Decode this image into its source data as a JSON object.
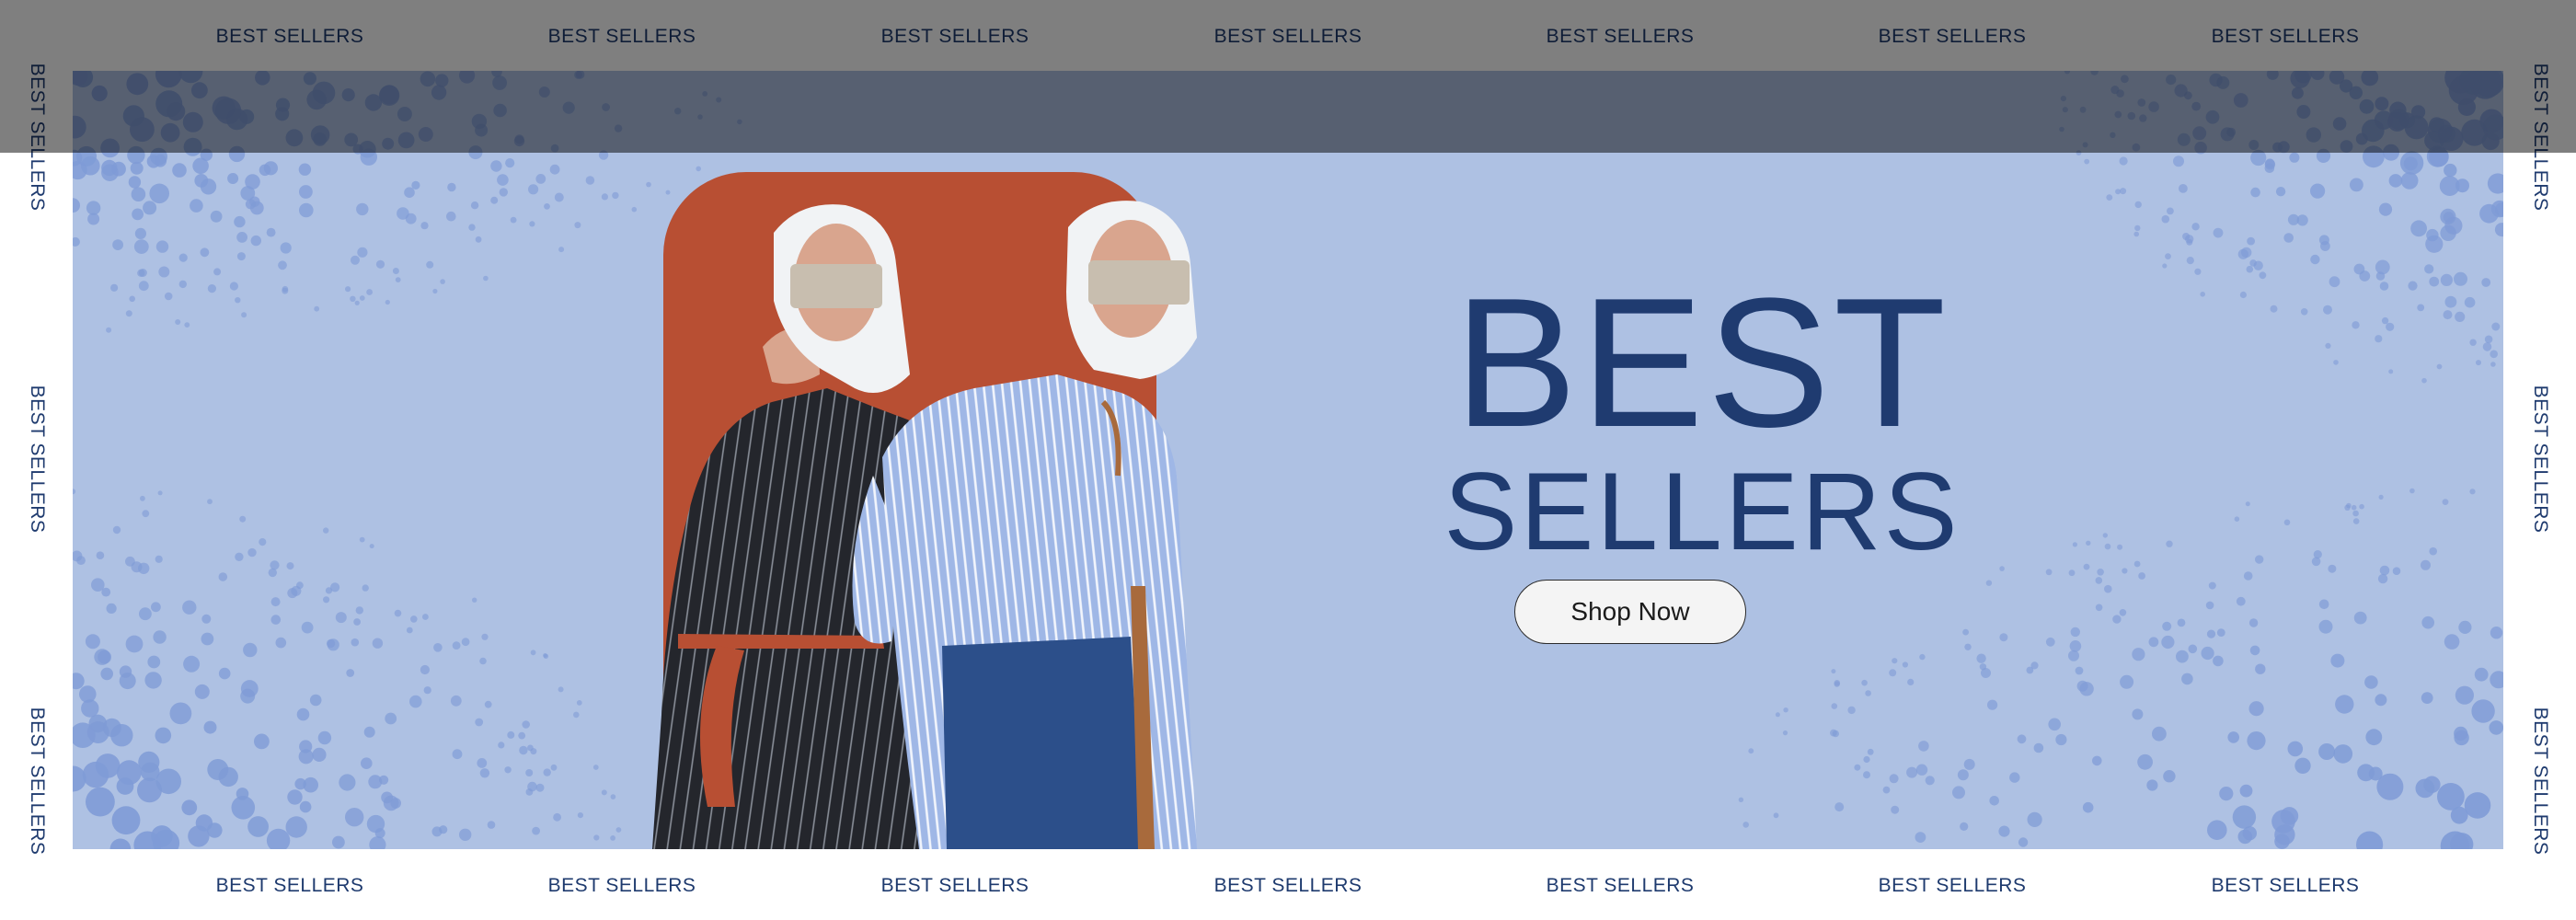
{
  "ticker": {
    "top": [
      "BEST SELLERS",
      "BEST SELLERS",
      "BEST SELLERS",
      "BEST SELLERS",
      "BEST SELLERS",
      "BEST SELLERS",
      "BEST SELLERS"
    ],
    "bottom": [
      "BEST SELLERS",
      "BEST SELLERS",
      "BEST SELLERS",
      "BEST SELLERS",
      "BEST SELLERS",
      "BEST SELLERS",
      "BEST SELLERS"
    ],
    "left": [
      "BEST SELLERS",
      "BEST SELLERS",
      "BEST SELLERS"
    ],
    "right": [
      "BEST SELLERS",
      "BEST SELLERS",
      "BEST SELLERS"
    ]
  },
  "hero": {
    "title_line1": "BEST",
    "title_line2": "SELLERS",
    "cta_label": "Shop Now"
  },
  "colors": {
    "banner_bg": "#aec1e3",
    "dots": "#7f9bd6",
    "title": "#1f3b70",
    "ticker_text": "#1e3a6e",
    "accent_panel": "#b84f33",
    "overlay": "rgba(0,0,0,0.5)"
  },
  "images": {
    "models": "two-models-photo"
  }
}
